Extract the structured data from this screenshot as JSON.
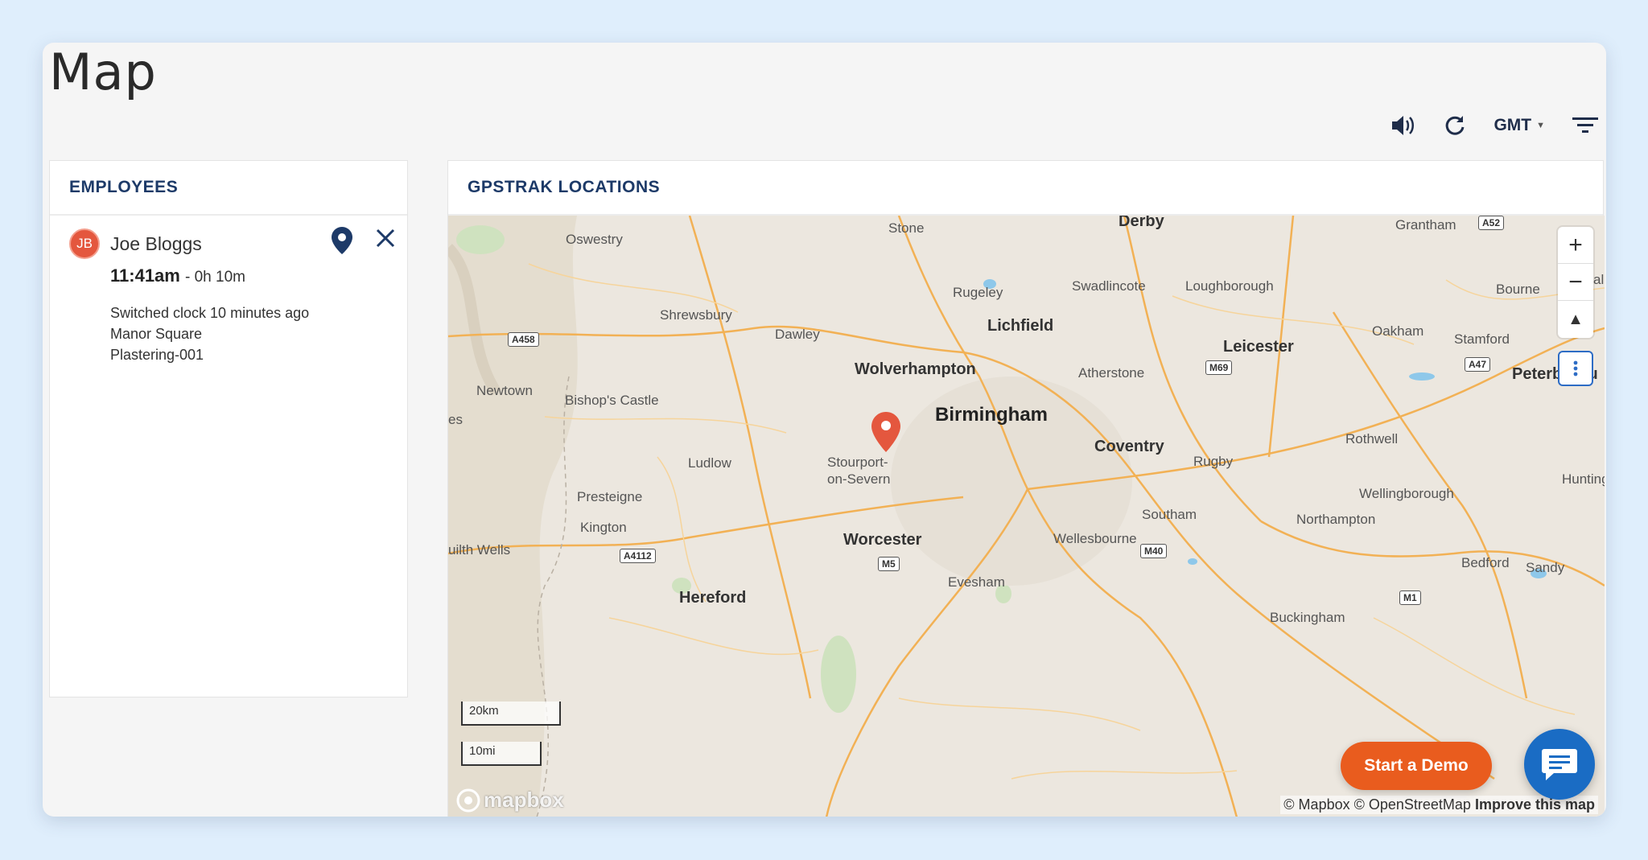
{
  "page": {
    "title": "Map"
  },
  "toolbar": {
    "timezone": "GMT"
  },
  "employees_panel": {
    "header": "EMPLOYEES",
    "items": [
      {
        "initials": "JB",
        "name": "Joe Bloggs",
        "time": "11:41am",
        "duration": "- 0h 10m",
        "status": "Switched clock 10 minutes ago",
        "location": "Manor Square",
        "job": "Plastering-001"
      }
    ]
  },
  "map_panel": {
    "header": "GPSTRAK LOCATIONS",
    "places": {
      "derby": "Derby",
      "stone": "Stone",
      "grantham": "Grantham",
      "oswestry": "Oswestry",
      "rugeley": "Rugeley",
      "swadlincote": "Swadlincote",
      "loughborough": "Loughborough",
      "bourne": "Bourne",
      "shrewsbury": "Shrewsbury",
      "dawley": "Dawley",
      "lichfield": "Lichfield",
      "leicester": "Leicester",
      "oakham": "Oakham",
      "stamford": "Stamford",
      "newtown": "Newtown",
      "wolverhampton": "Wolverhampton",
      "atherstone": "Atherstone",
      "peterborough": "Peterborou",
      "bishops_castle": "Bishop's Castle",
      "birmingham": "Birmingham",
      "coventry": "Coventry",
      "rothwell": "Rothwell",
      "ludlow": "Ludlow",
      "stourport": "Stourport-\non-Severn",
      "rugby": "Rugby",
      "hunting": "Hunting",
      "presteigne": "Presteigne",
      "wellingborough": "Wellingborough",
      "southam": "Southam",
      "kington": "Kington",
      "northampton": "Northampton",
      "builth_wells": "uilth Wells",
      "worcester": "Worcester",
      "wellesbourne": "Wellesbourne",
      "bedford": "Bedford",
      "sandy": "Sandy",
      "evesham": "Evesham",
      "hereford": "Hereford",
      "buckingham": "Buckingham",
      "es": "es",
      "al": "al"
    },
    "roads": {
      "a52": "A52",
      "a458": "A458",
      "m69": "M69",
      "a47": "A47",
      "a4112": "A4112",
      "m5": "M5",
      "m40": "M40",
      "m1": "M1"
    },
    "scale": {
      "km": "20km",
      "mi": "10mi"
    },
    "logo": "mapbox",
    "attribution": {
      "text": "© Mapbox © OpenStreetMap",
      "link": "Improve this map"
    },
    "marker_icon": "map-pin-icon",
    "colors": {
      "marker": "#e4573e",
      "roads": "#f2b155",
      "water": "#8ec8ea",
      "land": "#ece7df"
    }
  },
  "cta": {
    "demo_label": "Start a Demo"
  },
  "colors": {
    "accent": "#e95c1e",
    "chat": "#1a6cc4",
    "header_text": "#1d3a68"
  }
}
